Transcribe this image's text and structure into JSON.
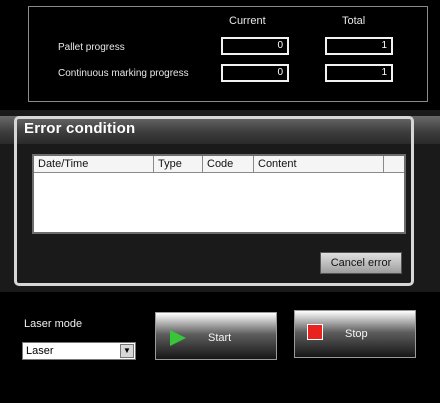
{
  "progress": {
    "col_current": "Current",
    "col_total": "Total",
    "rows": [
      {
        "label": "Pallet progress",
        "current": "0",
        "total": "1"
      },
      {
        "label": "Continuous marking progress",
        "current": "0",
        "total": "1"
      }
    ]
  },
  "error_condition": {
    "title": "Error condition",
    "columns": [
      "Date/Time",
      "Type",
      "Code",
      "Content"
    ],
    "rows": [],
    "cancel_label": "Cancel error"
  },
  "laser_mode": {
    "label": "Laser mode",
    "selected": "Laser"
  },
  "controls": {
    "start_label": "Start",
    "stop_label": "Stop"
  },
  "colors": {
    "start_icon": "#39c539",
    "stop_icon": "#e8221e"
  },
  "icons": {
    "start": "play-icon",
    "stop": "stop-square-icon",
    "dropdown": "chevron-down-icon"
  }
}
